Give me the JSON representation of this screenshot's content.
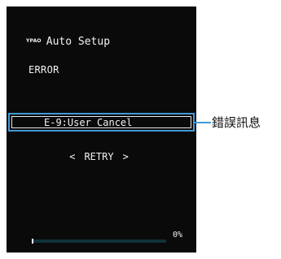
{
  "screen": {
    "logo_text": "YPAO",
    "title": "Auto Setup",
    "status_label": "ERROR",
    "error_message": "E-9:User Cancel",
    "retry": {
      "left_arrow": "<",
      "label": "RETRY",
      "right_arrow": ">"
    },
    "progress": {
      "percent_text": "0%",
      "value_fraction": 0.01
    }
  },
  "callout": {
    "label": "錯誤訊息"
  },
  "colors": {
    "screen_bg": "#0a0a0a",
    "text": "#f2f2f2",
    "highlight_border": "#3f9ad6",
    "progress_track": "#10313a"
  }
}
